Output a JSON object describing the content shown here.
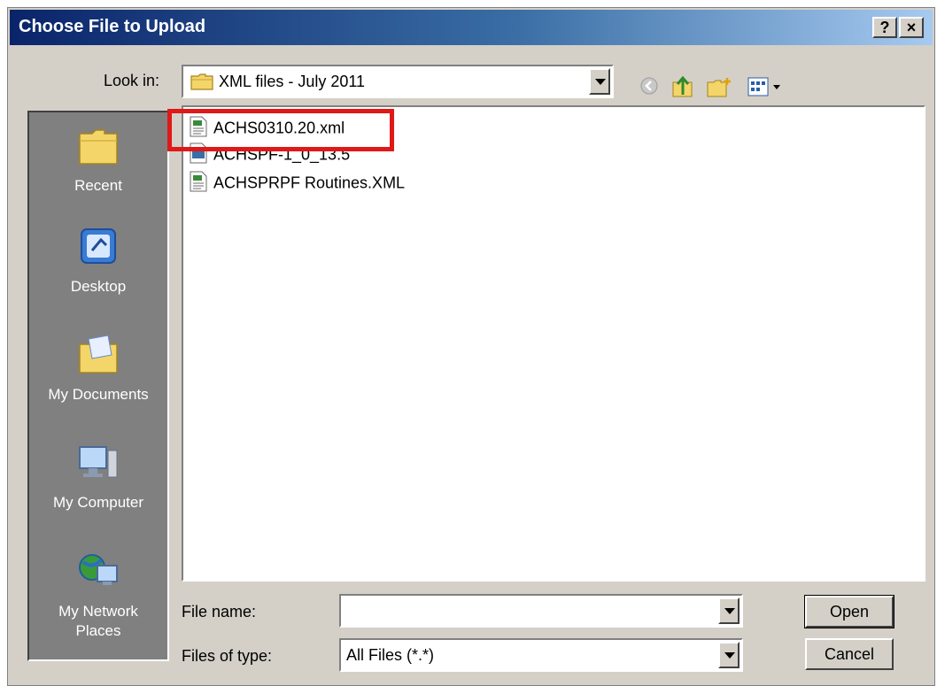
{
  "window": {
    "title": "Choose File to Upload",
    "help_label": "?",
    "close_label": "×"
  },
  "lookin": {
    "label": "Look in:",
    "value": "XML files  - July 2011"
  },
  "places": [
    {
      "label": "Recent",
      "icon": "folder-icon"
    },
    {
      "label": "Desktop",
      "icon": "desktop-icon"
    },
    {
      "label": "My Documents",
      "icon": "my-documents-icon"
    },
    {
      "label": "My Computer",
      "icon": "my-computer-icon"
    },
    {
      "label": "My Network Places",
      "icon": "network-icon"
    }
  ],
  "files": [
    {
      "name": "ACHS0310.20.xml",
      "icon": "xml-file-icon"
    },
    {
      "name": "ACHSPF-1_0_13.5",
      "icon": "file-icon"
    },
    {
      "name": "ACHSPRPF Routines.XML",
      "icon": "xml-file-icon"
    }
  ],
  "filename": {
    "label": "File name:",
    "value": ""
  },
  "filetype": {
    "label": "Files of type:",
    "value": "All Files (*.*)"
  },
  "buttons": {
    "open": "Open",
    "cancel": "Cancel"
  },
  "colors": {
    "titlebar_start": "#0a246a",
    "titlebar_end": "#a6caf0",
    "highlight": "#e01818"
  }
}
